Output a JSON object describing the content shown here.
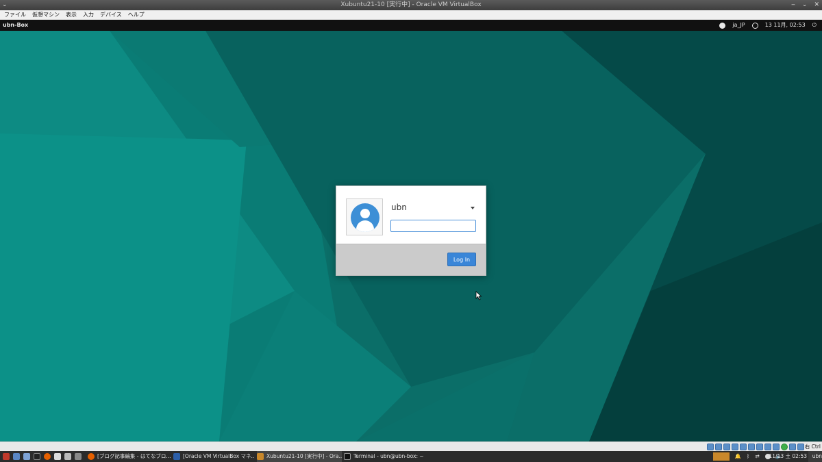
{
  "window": {
    "title": "Xubuntu21-10 [実行中] - Oracle VM VirtualBox"
  },
  "vbox_menu": {
    "items": [
      "ファイル",
      "仮想マシン",
      "表示",
      "入力",
      "デバイス",
      "ヘルプ"
    ]
  },
  "guest_panel": {
    "hostname": "ubn-Box",
    "keyboard": "ja_JP",
    "datetime": "13 11月, 02:53"
  },
  "login": {
    "username": "ubn",
    "password_value": "",
    "login_label": "Log In"
  },
  "vbox_status": {
    "host_key": "右 Ctrl"
  },
  "taskbar": {
    "tasks": [
      {
        "label": "[ブログ記事編集 - はてなブロ..."
      },
      {
        "label": "[Oracle VM VirtualBox マネ..."
      },
      {
        "label": "Xubuntu21-10 [実行中] - Ora..."
      },
      {
        "label": "Terminal - ubn@ubn-box: ~"
      }
    ],
    "clock": "11/13 土 02:53",
    "user": "ubn"
  },
  "colors": {
    "desktop_base": "#0b6e68",
    "login_accent": "#3a86d8",
    "avatar": "#3d8fd6"
  }
}
